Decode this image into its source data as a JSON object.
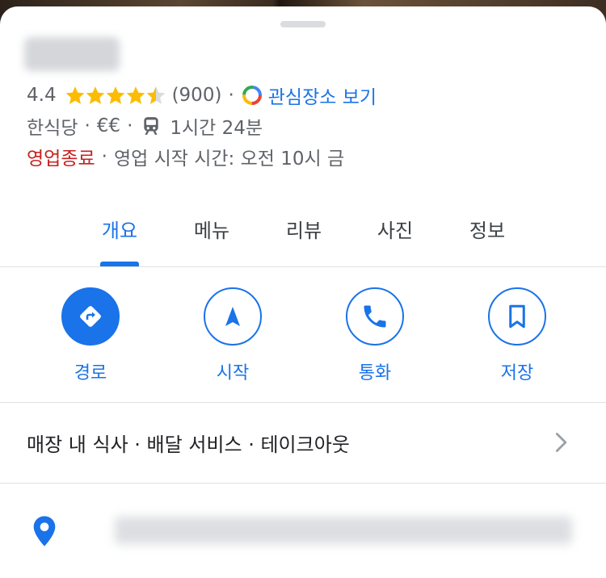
{
  "place": {
    "name": "",
    "rating": "4.4",
    "stars_filled": 4.5,
    "review_count": "(900)",
    "explore_link": "관심장소 보기",
    "category": "한식당",
    "price": "€€",
    "transit_time": "1시간 24분",
    "status": "영업종료",
    "hours": "영업 시작 시간: 오전 10시 금",
    "separator": "·"
  },
  "tabs": [
    {
      "label": "개요",
      "active": true
    },
    {
      "label": "메뉴",
      "active": false
    },
    {
      "label": "리뷰",
      "active": false
    },
    {
      "label": "사진",
      "active": false
    },
    {
      "label": "정보",
      "active": false
    }
  ],
  "actions": [
    {
      "label": "경로",
      "icon": "directions-icon"
    },
    {
      "label": "시작",
      "icon": "navigation-arrow-icon"
    },
    {
      "label": "통화",
      "icon": "phone-icon"
    },
    {
      "label": "저장",
      "icon": "bookmark-icon"
    }
  ],
  "services": {
    "text": "매장 내 식사 · 배달 서비스 · 테이크아웃"
  },
  "address": {
    "text": ""
  },
  "colors": {
    "accent": "#1a73e8",
    "closed": "#c5221f",
    "star": "#fbbc04",
    "text_secondary": "#5f6368"
  }
}
